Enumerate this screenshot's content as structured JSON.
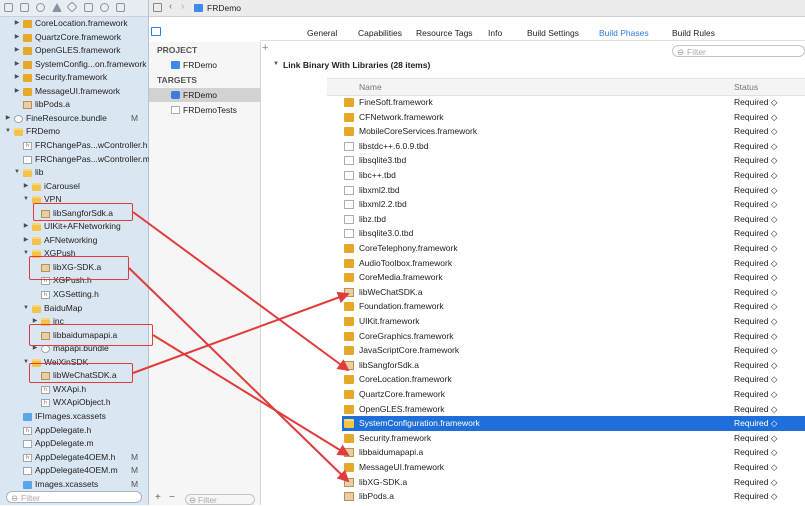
{
  "nav_items": [
    {
      "label": "CoreLocation.framework",
      "indent": 1,
      "icon": "toolbox",
      "disc": "▶"
    },
    {
      "label": "QuartzCore.framework",
      "indent": 1,
      "icon": "toolbox",
      "disc": "▶"
    },
    {
      "label": "OpenGLES.framework",
      "indent": 1,
      "icon": "toolbox",
      "disc": "▶"
    },
    {
      "label": "SystemConfig...on.framework",
      "indent": 1,
      "icon": "toolbox",
      "disc": "▶"
    },
    {
      "label": "Security.framework",
      "indent": 1,
      "icon": "toolbox",
      "disc": "▶"
    },
    {
      "label": "MessageUI.framework",
      "indent": 1,
      "icon": "toolbox",
      "disc": "▶"
    },
    {
      "label": "libPods.a",
      "indent": 1,
      "icon": "lib",
      "disc": ""
    },
    {
      "label": "FineResource.bundle",
      "indent": 0,
      "icon": "bundle",
      "disc": "▶",
      "badge": "M"
    },
    {
      "label": "FRDemo",
      "indent": 0,
      "icon": "folder",
      "disc": "▼"
    },
    {
      "label": "FRChangePas...wController.h",
      "indent": 1,
      "icon": "file-h",
      "disc": ""
    },
    {
      "label": "FRChangePas...wController.m",
      "indent": 1,
      "icon": "file-m",
      "disc": ""
    },
    {
      "label": "lib",
      "indent": 1,
      "icon": "folder",
      "disc": "▼"
    },
    {
      "label": "iCarousel",
      "indent": 2,
      "icon": "folder",
      "disc": "▶"
    },
    {
      "label": "VPN",
      "indent": 2,
      "icon": "folder",
      "disc": "▼"
    },
    {
      "label": "libSangforSdk.a",
      "indent": 3,
      "icon": "lib",
      "disc": ""
    },
    {
      "label": "UIKit+AFNetworking",
      "indent": 2,
      "icon": "folder",
      "disc": "▶"
    },
    {
      "label": "AFNetworking",
      "indent": 2,
      "icon": "folder",
      "disc": "▶"
    },
    {
      "label": "XGPush",
      "indent": 2,
      "icon": "folder",
      "disc": "▼"
    },
    {
      "label": "libXG-SDK.a",
      "indent": 3,
      "icon": "lib",
      "disc": ""
    },
    {
      "label": "XGPush.h",
      "indent": 3,
      "icon": "file-h",
      "disc": ""
    },
    {
      "label": "XGSetting.h",
      "indent": 3,
      "icon": "file-h",
      "disc": ""
    },
    {
      "label": "BaiduMap",
      "indent": 2,
      "icon": "folder",
      "disc": "▼"
    },
    {
      "label": "inc",
      "indent": 3,
      "icon": "folder",
      "disc": "▶"
    },
    {
      "label": "libbaidumapapi.a",
      "indent": 3,
      "icon": "lib",
      "disc": ""
    },
    {
      "label": "mapapi.bundle",
      "indent": 3,
      "icon": "bundle",
      "disc": "▶"
    },
    {
      "label": "WeiXinSDK",
      "indent": 2,
      "icon": "folder",
      "disc": "▼"
    },
    {
      "label": "libWeChatSDK.a",
      "indent": 3,
      "icon": "lib",
      "disc": ""
    },
    {
      "label": "WXApi.h",
      "indent": 3,
      "icon": "file-h",
      "disc": ""
    },
    {
      "label": "WXApiObject.h",
      "indent": 3,
      "icon": "file-h",
      "disc": ""
    },
    {
      "label": "IFImages.xcassets",
      "indent": 1,
      "icon": "assets",
      "disc": ""
    },
    {
      "label": "AppDelegate.h",
      "indent": 1,
      "icon": "file-h",
      "disc": ""
    },
    {
      "label": "AppDelegate.m",
      "indent": 1,
      "icon": "file-m",
      "disc": ""
    },
    {
      "label": "AppDelegate4OEM.h",
      "indent": 1,
      "icon": "file-h",
      "disc": "",
      "badge": "M"
    },
    {
      "label": "AppDelegate4OEM.m",
      "indent": 1,
      "icon": "file-m",
      "disc": "",
      "badge": "M"
    },
    {
      "label": "Images.xcassets",
      "indent": 1,
      "icon": "assets",
      "disc": "",
      "badge": "M"
    }
  ],
  "nav_filter_placeholder": "Filter",
  "breadcrumb": {
    "project": "FRDemo"
  },
  "tabs": [
    "General",
    "Capabilities",
    "Resource Tags",
    "Info",
    "Build Settings",
    "Build Phases",
    "Build Rules"
  ],
  "active_tab": "Build Phases",
  "project_section": "PROJECT",
  "project_name": "FRDemo",
  "targets_section": "TARGETS",
  "targets": [
    "FRDemo",
    "FRDemoTests"
  ],
  "add_label": "+",
  "remove_label": "−",
  "mid_filter_placeholder": "Filter",
  "phase_filter_placeholder": "Filter",
  "phase_title": "Link Binary With Libraries (28 items)",
  "col_name": "Name",
  "col_status": "Status",
  "status_value": "Required ◇",
  "libraries": [
    {
      "name": "FineSoft.framework",
      "icon": "toolbox"
    },
    {
      "name": "CFNetwork.framework",
      "icon": "toolbox"
    },
    {
      "name": "MobileCoreServices.framework",
      "icon": "toolbox"
    },
    {
      "name": "libstdc++.6.0.9.tbd",
      "icon": "tbd"
    },
    {
      "name": "libsqlite3.tbd",
      "icon": "tbd"
    },
    {
      "name": "libc++.tbd",
      "icon": "tbd"
    },
    {
      "name": "libxml2.tbd",
      "icon": "tbd"
    },
    {
      "name": "libxml2.2.tbd",
      "icon": "tbd"
    },
    {
      "name": "libz.tbd",
      "icon": "tbd"
    },
    {
      "name": "libsqlite3.0.tbd",
      "icon": "tbd"
    },
    {
      "name": "CoreTelephony.framework",
      "icon": "toolbox"
    },
    {
      "name": "AudioToolbox.framework",
      "icon": "toolbox"
    },
    {
      "name": "CoreMedia.framework",
      "icon": "toolbox"
    },
    {
      "name": "libWeChatSDK.a",
      "icon": "lib"
    },
    {
      "name": "Foundation.framework",
      "icon": "toolbox"
    },
    {
      "name": "UIKit.framework",
      "icon": "toolbox"
    },
    {
      "name": "CoreGraphics.framework",
      "icon": "toolbox"
    },
    {
      "name": "JavaScriptCore.framework",
      "icon": "toolbox"
    },
    {
      "name": "libSangforSdk.a",
      "icon": "lib"
    },
    {
      "name": "CoreLocation.framework",
      "icon": "toolbox"
    },
    {
      "name": "QuartzCore.framework",
      "icon": "toolbox"
    },
    {
      "name": "OpenGLES.framework",
      "icon": "toolbox"
    },
    {
      "name": "SystemConfiguration.framework",
      "icon": "toolbox",
      "selected": true
    },
    {
      "name": "Security.framework",
      "icon": "toolbox"
    },
    {
      "name": "libbaidumapapi.a",
      "icon": "lib"
    },
    {
      "name": "MessageUI.framework",
      "icon": "toolbox"
    },
    {
      "name": "libXG-SDK.a",
      "icon": "lib"
    },
    {
      "name": "libPods.a",
      "icon": "lib"
    }
  ],
  "colors": {
    "accent": "#2f7ae5",
    "selection": "#1e6fd9",
    "annotation": "#e03c3c",
    "sidebar": "#dbe6f3"
  }
}
